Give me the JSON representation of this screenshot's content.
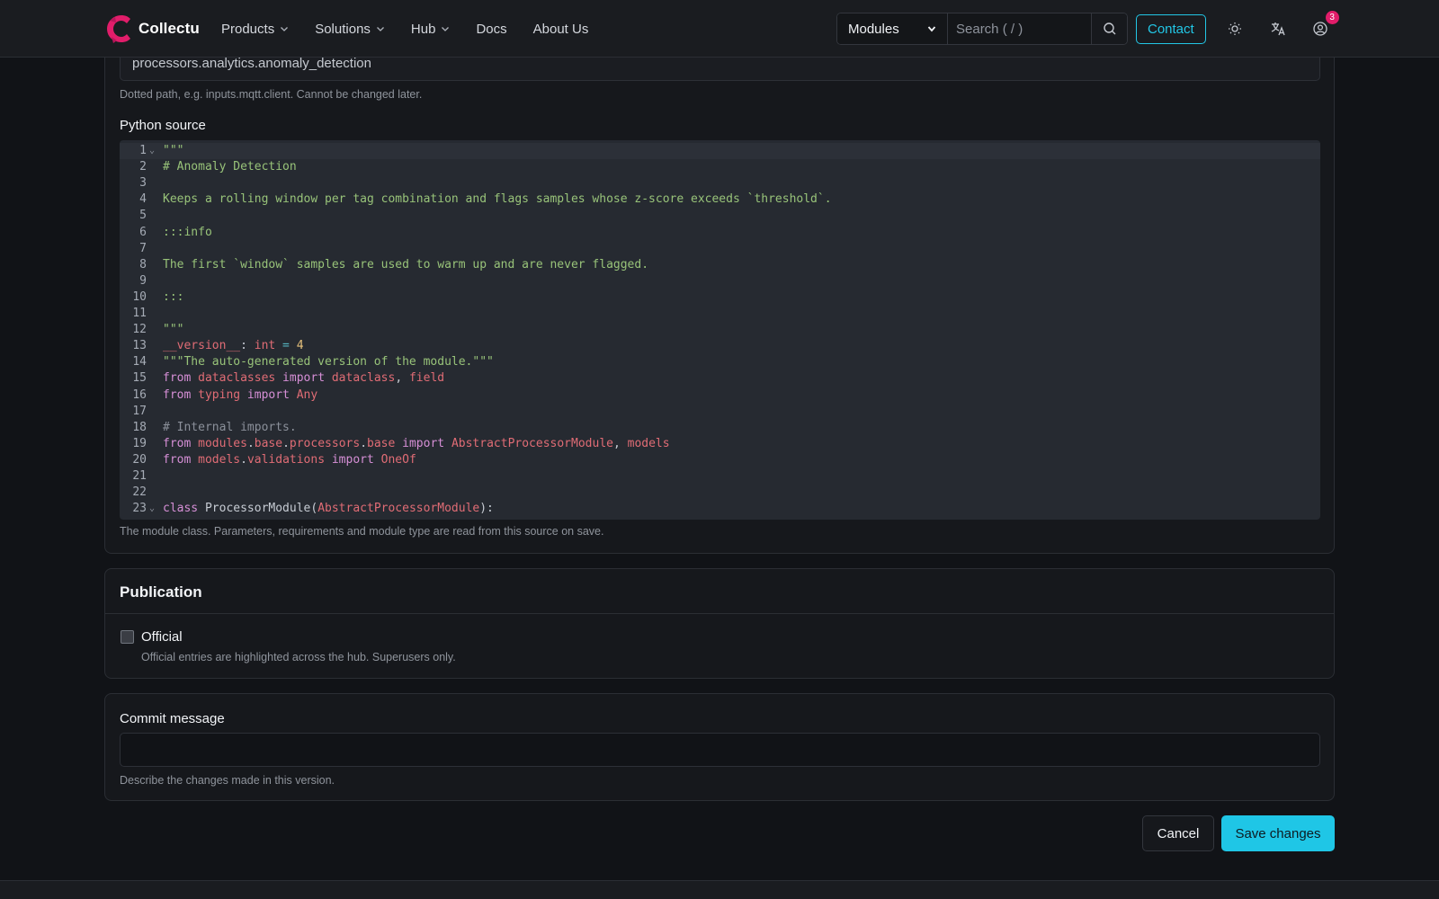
{
  "nav": {
    "brand": "Collectu",
    "links": [
      {
        "label": "Products",
        "has_dropdown": true
      },
      {
        "label": "Solutions",
        "has_dropdown": true
      },
      {
        "label": "Hub",
        "has_dropdown": true
      },
      {
        "label": "Docs",
        "has_dropdown": false
      },
      {
        "label": "About Us",
        "has_dropdown": false
      }
    ],
    "search_scope": "Modules",
    "search_placeholder": "Search ( / )",
    "contact": "Contact",
    "notification_count": "3",
    "icons": [
      "brand-logo-icon",
      "search-icon",
      "sun-icon",
      "translate-icon",
      "user-circle-icon"
    ]
  },
  "form": {
    "module_path": "processors.analytics.anomaly_detection",
    "module_path_help": "Dotted path, e.g. inputs.mqtt.client. Cannot be changed later.",
    "python_source_label": "Python source",
    "python_source_help": "The module class. Parameters, requirements and module type are read from this source on save.",
    "code_lines": [
      {
        "n": "1",
        "fold": true,
        "parts": [
          {
            "t": "\"\"\"",
            "c": "t-str"
          }
        ]
      },
      {
        "n": "2",
        "fold": false,
        "parts": [
          {
            "t": "# Anomaly Detection",
            "c": "t-str"
          }
        ]
      },
      {
        "n": "3",
        "fold": false,
        "parts": []
      },
      {
        "n": "4",
        "fold": false,
        "parts": [
          {
            "t": "Keeps a rolling window per tag combination and flags samples whose z-score exceeds `threshold`.",
            "c": "t-str"
          }
        ]
      },
      {
        "n": "5",
        "fold": false,
        "parts": []
      },
      {
        "n": "6",
        "fold": false,
        "parts": [
          {
            "t": ":::info",
            "c": "t-str"
          }
        ]
      },
      {
        "n": "7",
        "fold": false,
        "parts": []
      },
      {
        "n": "8",
        "fold": false,
        "parts": [
          {
            "t": "The first `window` samples are used to warm up and are never flagged.",
            "c": "t-str"
          }
        ]
      },
      {
        "n": "9",
        "fold": false,
        "parts": []
      },
      {
        "n": "10",
        "fold": false,
        "parts": [
          {
            "t": ":::",
            "c": "t-str"
          }
        ]
      },
      {
        "n": "11",
        "fold": false,
        "parts": []
      },
      {
        "n": "12",
        "fold": false,
        "parts": [
          {
            "t": "\"\"\"",
            "c": "t-str"
          }
        ]
      },
      {
        "n": "13",
        "fold": false,
        "parts": [
          {
            "t": "__version__",
            "c": "t-mod"
          },
          {
            "t": ": ",
            "c": "t-plain"
          },
          {
            "t": "int",
            "c": "t-mod"
          },
          {
            "t": " = ",
            "c": "t-op"
          },
          {
            "t": "4",
            "c": "t-num"
          }
        ]
      },
      {
        "n": "14",
        "fold": false,
        "parts": [
          {
            "t": "\"\"\"The auto-generated version of the module.\"\"\"",
            "c": "t-str"
          }
        ]
      },
      {
        "n": "15",
        "fold": false,
        "parts": [
          {
            "t": "from ",
            "c": "t-kw"
          },
          {
            "t": "dataclasses",
            "c": "t-mod"
          },
          {
            "t": " import ",
            "c": "t-kw"
          },
          {
            "t": "dataclass",
            "c": "t-mod"
          },
          {
            "t": ", ",
            "c": "t-plain"
          },
          {
            "t": "field",
            "c": "t-mod"
          }
        ]
      },
      {
        "n": "16",
        "fold": false,
        "parts": [
          {
            "t": "from ",
            "c": "t-kw"
          },
          {
            "t": "typing",
            "c": "t-mod"
          },
          {
            "t": " import ",
            "c": "t-kw"
          },
          {
            "t": "Any",
            "c": "t-mod"
          }
        ]
      },
      {
        "n": "17",
        "fold": false,
        "parts": []
      },
      {
        "n": "18",
        "fold": false,
        "parts": [
          {
            "t": "# Internal imports.",
            "c": "t-cmt"
          }
        ]
      },
      {
        "n": "19",
        "fold": false,
        "parts": [
          {
            "t": "from ",
            "c": "t-kw"
          },
          {
            "t": "modules",
            "c": "t-mod"
          },
          {
            "t": ".",
            "c": "t-plain"
          },
          {
            "t": "base",
            "c": "t-mod"
          },
          {
            "t": ".",
            "c": "t-plain"
          },
          {
            "t": "processors",
            "c": "t-mod"
          },
          {
            "t": ".",
            "c": "t-plain"
          },
          {
            "t": "base",
            "c": "t-mod"
          },
          {
            "t": " import ",
            "c": "t-kw"
          },
          {
            "t": "AbstractProcessorModule",
            "c": "t-mod"
          },
          {
            "t": ", ",
            "c": "t-plain"
          },
          {
            "t": "models",
            "c": "t-mod"
          }
        ]
      },
      {
        "n": "20",
        "fold": false,
        "parts": [
          {
            "t": "from ",
            "c": "t-kw"
          },
          {
            "t": "models",
            "c": "t-mod"
          },
          {
            "t": ".",
            "c": "t-plain"
          },
          {
            "t": "validations",
            "c": "t-mod"
          },
          {
            "t": " import ",
            "c": "t-kw"
          },
          {
            "t": "OneOf",
            "c": "t-mod"
          }
        ]
      },
      {
        "n": "21",
        "fold": false,
        "parts": []
      },
      {
        "n": "22",
        "fold": false,
        "parts": []
      },
      {
        "n": "23",
        "fold": true,
        "parts": [
          {
            "t": "class ",
            "c": "t-kw"
          },
          {
            "t": "ProcessorModule",
            "c": "t-plain"
          },
          {
            "t": "(",
            "c": "t-plain"
          },
          {
            "t": "AbstractProcessorModule",
            "c": "t-mod"
          },
          {
            "t": "):",
            "c": "t-plain"
          }
        ]
      }
    ]
  },
  "publication": {
    "title": "Publication",
    "official_label": "Official",
    "official_checked": false,
    "official_help": "Official entries are highlighted across the hub. Superusers only."
  },
  "commit": {
    "label": "Commit message",
    "value": "",
    "help": "Describe the changes made in this version."
  },
  "actions": {
    "cancel": "Cancel",
    "save": "Save changes"
  },
  "colors": {
    "accent": "#1fc6e6",
    "brand": "#e11d6a",
    "background": "#111317",
    "card": "#16181c"
  }
}
